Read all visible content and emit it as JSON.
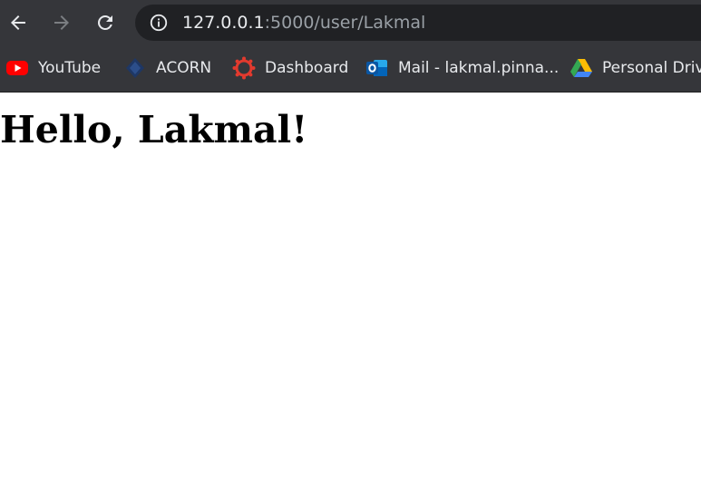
{
  "browser": {
    "url_host": "127.0.0.1",
    "url_path": ":5000/user/Lakmal",
    "icons": {
      "back": "back-arrow-icon",
      "forward": "forward-arrow-icon",
      "reload": "reload-icon",
      "info": "info-icon"
    }
  },
  "bookmarks": [
    {
      "label": "YouTube",
      "icon": "youtube-icon"
    },
    {
      "label": "ACORN",
      "icon": "acorn-icon"
    },
    {
      "label": "Dashboard",
      "icon": "dashboard-icon"
    },
    {
      "label": "Mail - lakmal.pinna...",
      "icon": "outlook-icon"
    },
    {
      "label": "Personal Drive",
      "icon": "google-drive-icon"
    }
  ],
  "page": {
    "heading": "Hello, Lakmal!"
  },
  "colors": {
    "toolbar_bg": "#35363a",
    "omnibox_bg": "#202124",
    "page_bg": "#ffffff"
  }
}
